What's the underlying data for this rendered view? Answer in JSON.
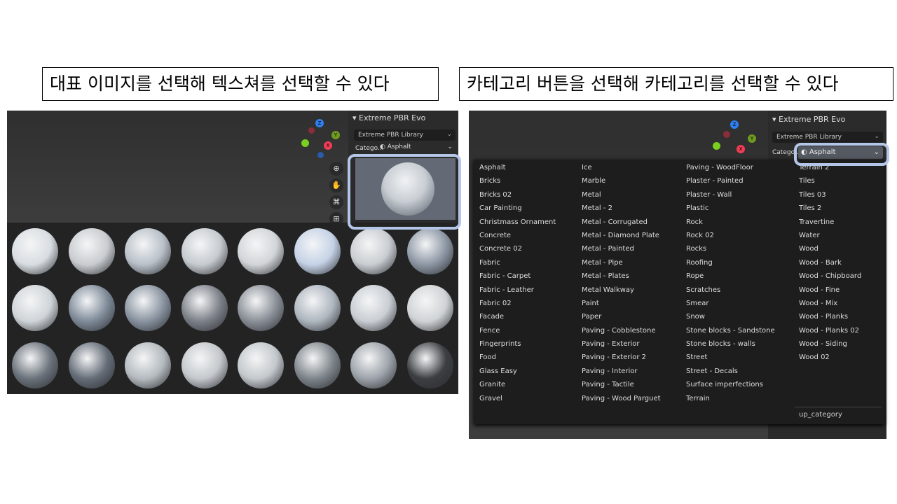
{
  "captions": {
    "left": "대표 이미지를 선택해 텍스쳐를 선택할 수 있다",
    "right": "카테고리 버튼을 선택해 카테고리를 선택할 수 있다"
  },
  "panel": {
    "title": "Extreme PBR Evo",
    "library": "Extreme PBR Library",
    "category_label": "Catego...",
    "category_value": "Asphalt"
  },
  "gizmo": {
    "z": "Z",
    "y": "Y",
    "x": "X"
  },
  "nav_icons": [
    "zoom-icon",
    "hand-pan-icon",
    "camera-icon",
    "grid-icon"
  ],
  "highlight_color": "#b4c6e7",
  "thumbnails": [
    "#d8dde2",
    "#c9ccd0",
    "#b9c0c8",
    "#c6cbd0",
    "#d2d5d8",
    "#c5d2e6",
    "#c9cdd1",
    "#8d97a4",
    "#cfd4d8",
    "#7f8b99",
    "#8993a0",
    "#7c8088",
    "#8b9098",
    "#aeb6bf",
    "#c9ced4",
    "#d0d3d5",
    "#6b727b",
    "#656d78",
    "#b4babf",
    "#c4c8cc",
    "#c3c8cc",
    "#7e858b",
    "#9da3aa",
    "#3c3e42"
  ],
  "dropdown": {
    "columns": [
      [
        "Asphalt",
        "Bricks",
        "Bricks 02",
        "Car Painting",
        "Christmass Ornament",
        "Concrete",
        "Concrete 02",
        "Fabric",
        "Fabric - Carpet",
        "Fabric - Leather",
        "Fabric 02",
        "Facade",
        "Fence",
        "Fingerprints",
        "Food",
        "Glass Easy",
        "Granite",
        "Gravel"
      ],
      [
        "Ice",
        "Marble",
        "Metal",
        "Metal - 2",
        "Metal - Corrugated",
        "Metal - Diamond Plate",
        "Metal - Painted",
        "Metal - Pipe",
        "Metal - Plates",
        "Metal Walkway",
        "Paint",
        "Paper",
        "Paving - Cobblestone",
        "Paving - Exterior",
        "Paving - Exterior 2",
        "Paving - Interior",
        "Paving - Tactile",
        "Paving - Wood Parguet"
      ],
      [
        "Paving - WoodFloor",
        "Plaster - Painted",
        "Plaster - Wall",
        "Plastic",
        "Rock",
        "Rock 02",
        "Rocks",
        "Roofing",
        "Rope",
        "Scratches",
        "Smear",
        "Snow",
        "Stone blocks - Sandstone",
        "Stone blocks - walls",
        "Street",
        "Street - Decals",
        "Surface imperfections",
        "Terrain"
      ],
      [
        "Terrain 2",
        "Tiles",
        "Tiles 03",
        "Tiles 2",
        "Travertine",
        "Water",
        "Wood",
        "Wood - Bark",
        "Wood - Chipboard",
        "Wood - Fine",
        "Wood - Mix",
        "Wood - Planks",
        "Wood - Planks 02",
        "Wood - Siding",
        "Wood 02"
      ]
    ],
    "footer": "up_category"
  }
}
